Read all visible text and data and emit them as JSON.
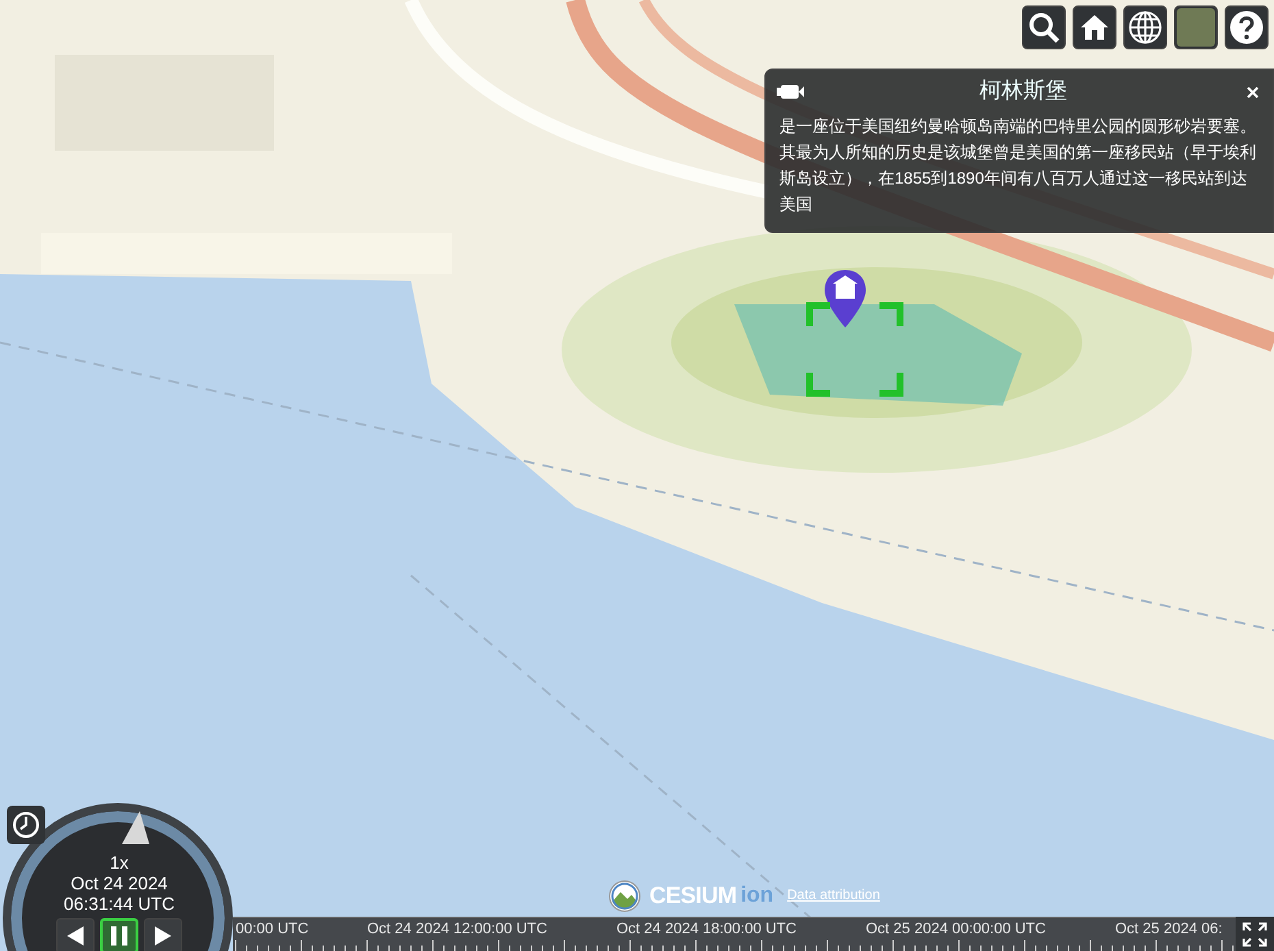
{
  "infobox": {
    "title": "柯林斯堡",
    "description": "是一座位于美国纽约曼哈顿岛南端的巴特里公园的圆形砂岩要塞。其最为人所知的历史是该城堡曾是美国的第一座移民站（早于埃利斯岛设立），在1855到1890年间有八百万人通过这一移民站到达美国"
  },
  "animation": {
    "speed": "1x",
    "date": "Oct 24 2024",
    "time": "06:31:44 UTC",
    "controls": [
      {
        "kind": "reverse",
        "selected": false
      },
      {
        "kind": "pause",
        "selected": true
      },
      {
        "kind": "play",
        "selected": false
      }
    ]
  },
  "credits": {
    "logo_text": "CESIUM",
    "logo_suffix": "ion",
    "link": "Data attribution"
  },
  "timeline": {
    "labels": [
      "00:00 UTC",
      "Oct 24 2024 12:00:00 UTC",
      "Oct 24 2024 18:00:00 UTC",
      "Oct 25 2024 00:00:00 UTC",
      "Oct 25 2024 06:"
    ]
  }
}
